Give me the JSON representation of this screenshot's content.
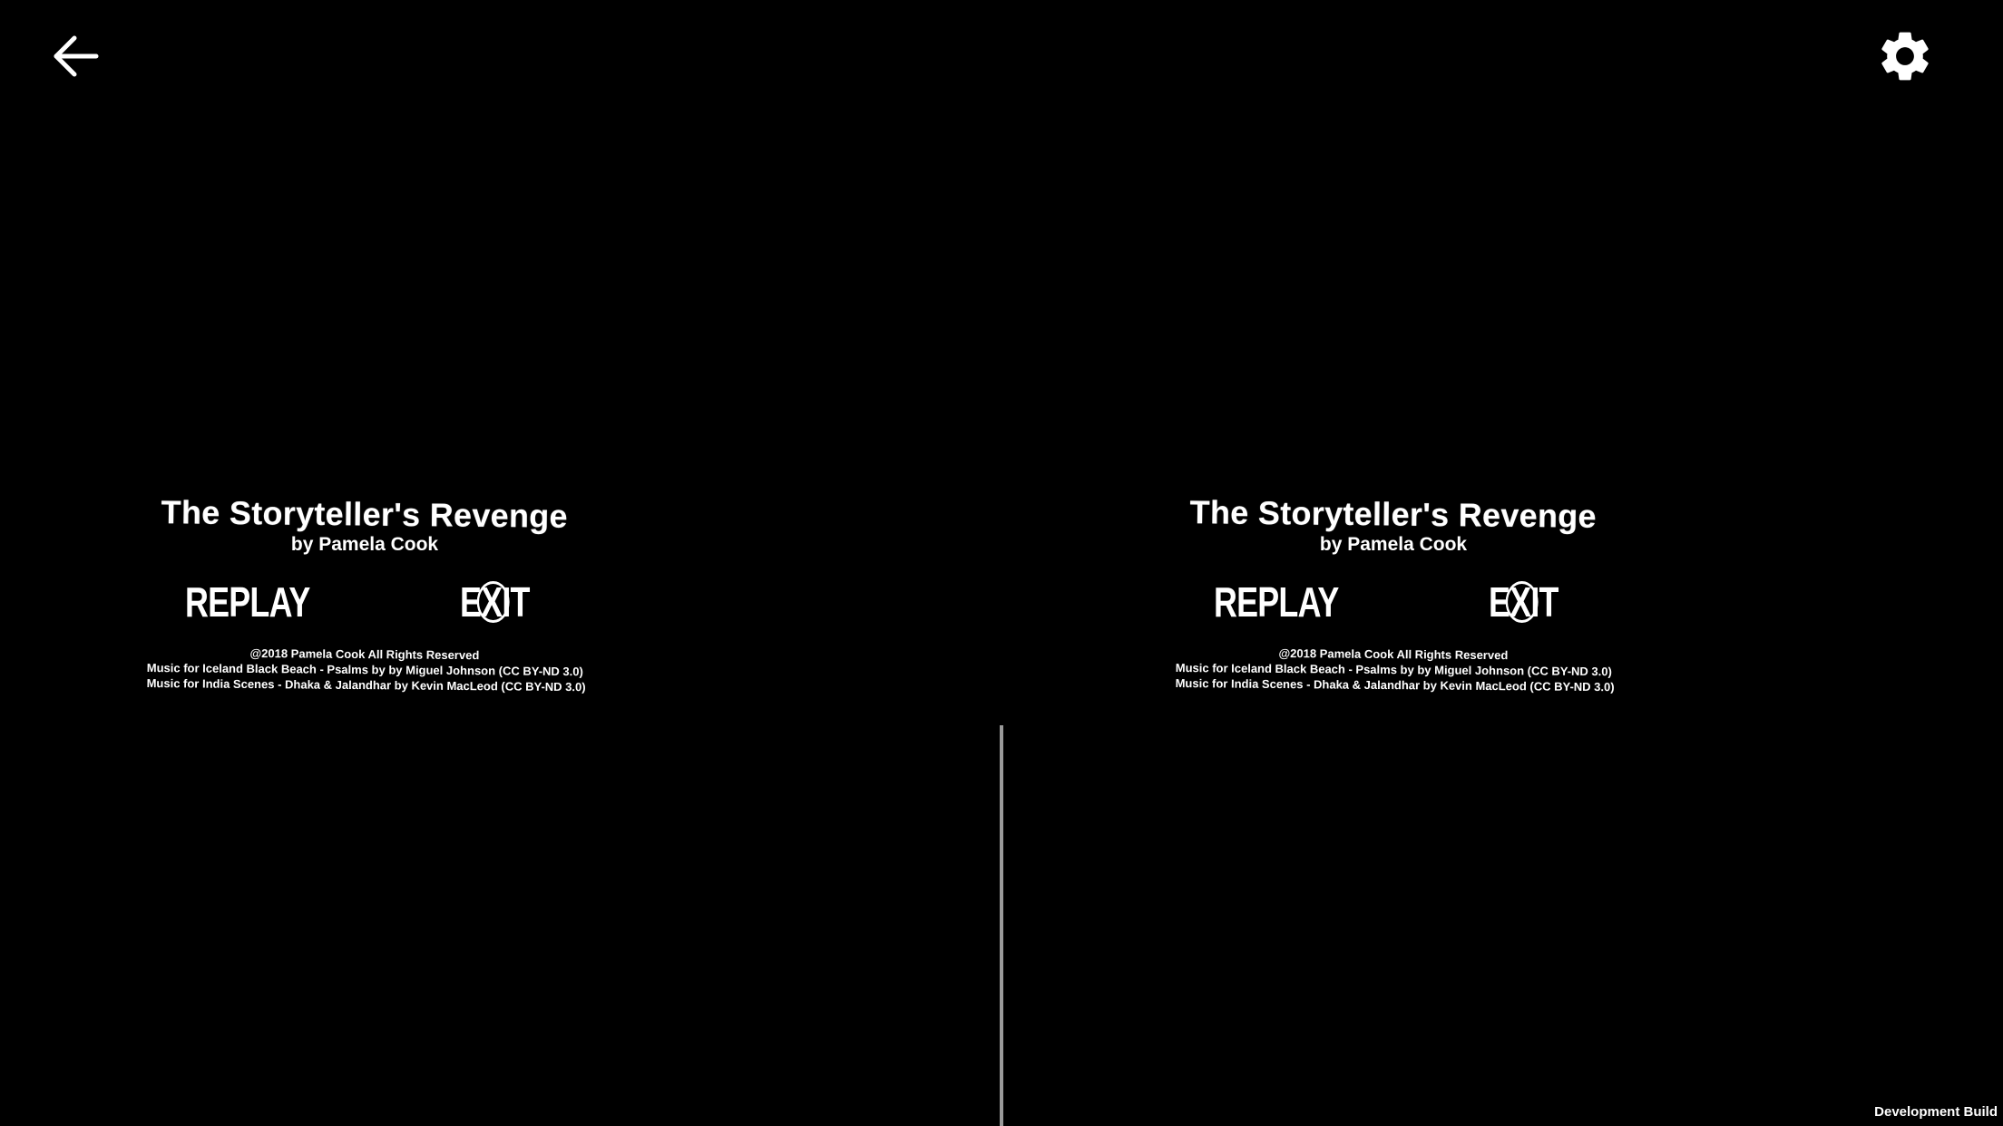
{
  "toolbar": {
    "back_icon": "arrow-left-icon",
    "settings_icon": "gear-icon"
  },
  "screen": {
    "title": "The Storyteller's Revenge",
    "byline": "by Pamela Cook",
    "replay_label": "REPLAY",
    "exit_label_pre": "E",
    "exit_label_x": "X",
    "exit_label_post": "IT",
    "credits": [
      "@2018 Pamela Cook All Rights Reserved",
      "Music for Iceland Black Beach - Psalms by  by Miguel Johnson (CC BY-ND 3.0)",
      "Music for India Scenes - Dhaka & Jalandhar by Kevin MacLeod (CC BY-ND 3.0)"
    ]
  },
  "footer": {
    "build_label": "Development Build"
  },
  "colors": {
    "background": "#000000",
    "text": "#ffffff",
    "divider": "#9a9a9a"
  }
}
